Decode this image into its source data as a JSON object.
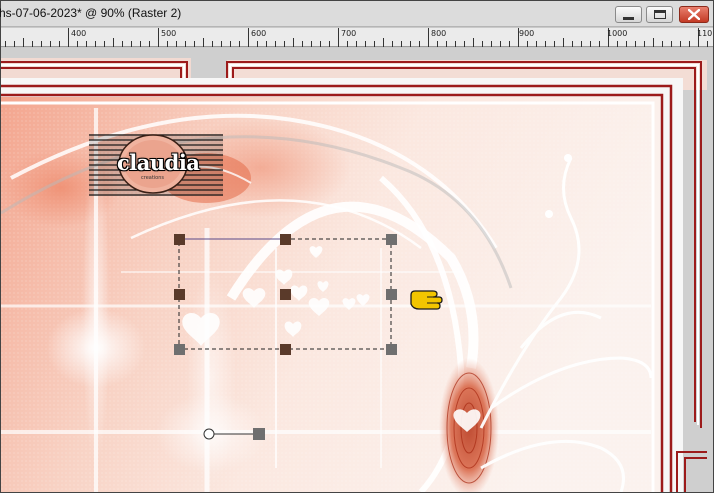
{
  "window": {
    "title": "hs-07-06-2023* @  90% (Raster 2)",
    "controls": [
      "minimize",
      "maximize",
      "close"
    ]
  },
  "ruler": {
    "labels": [
      "400",
      "500",
      "600",
      "700",
      "800",
      "900",
      "1000",
      "110"
    ]
  },
  "canvas": {
    "watermark_text": "claudia",
    "watermark_subtext": "creations",
    "colors": {
      "frame_red": "#9c1b1b",
      "background_peach": "#f4c6b6",
      "handle_gray": "#6f6f6f",
      "handle_brown": "#5a3a2a",
      "pointer_yellow": "#f2c500"
    },
    "icons": [
      "pick-tool-pointer-icon",
      "rotation-handle-icon"
    ]
  }
}
